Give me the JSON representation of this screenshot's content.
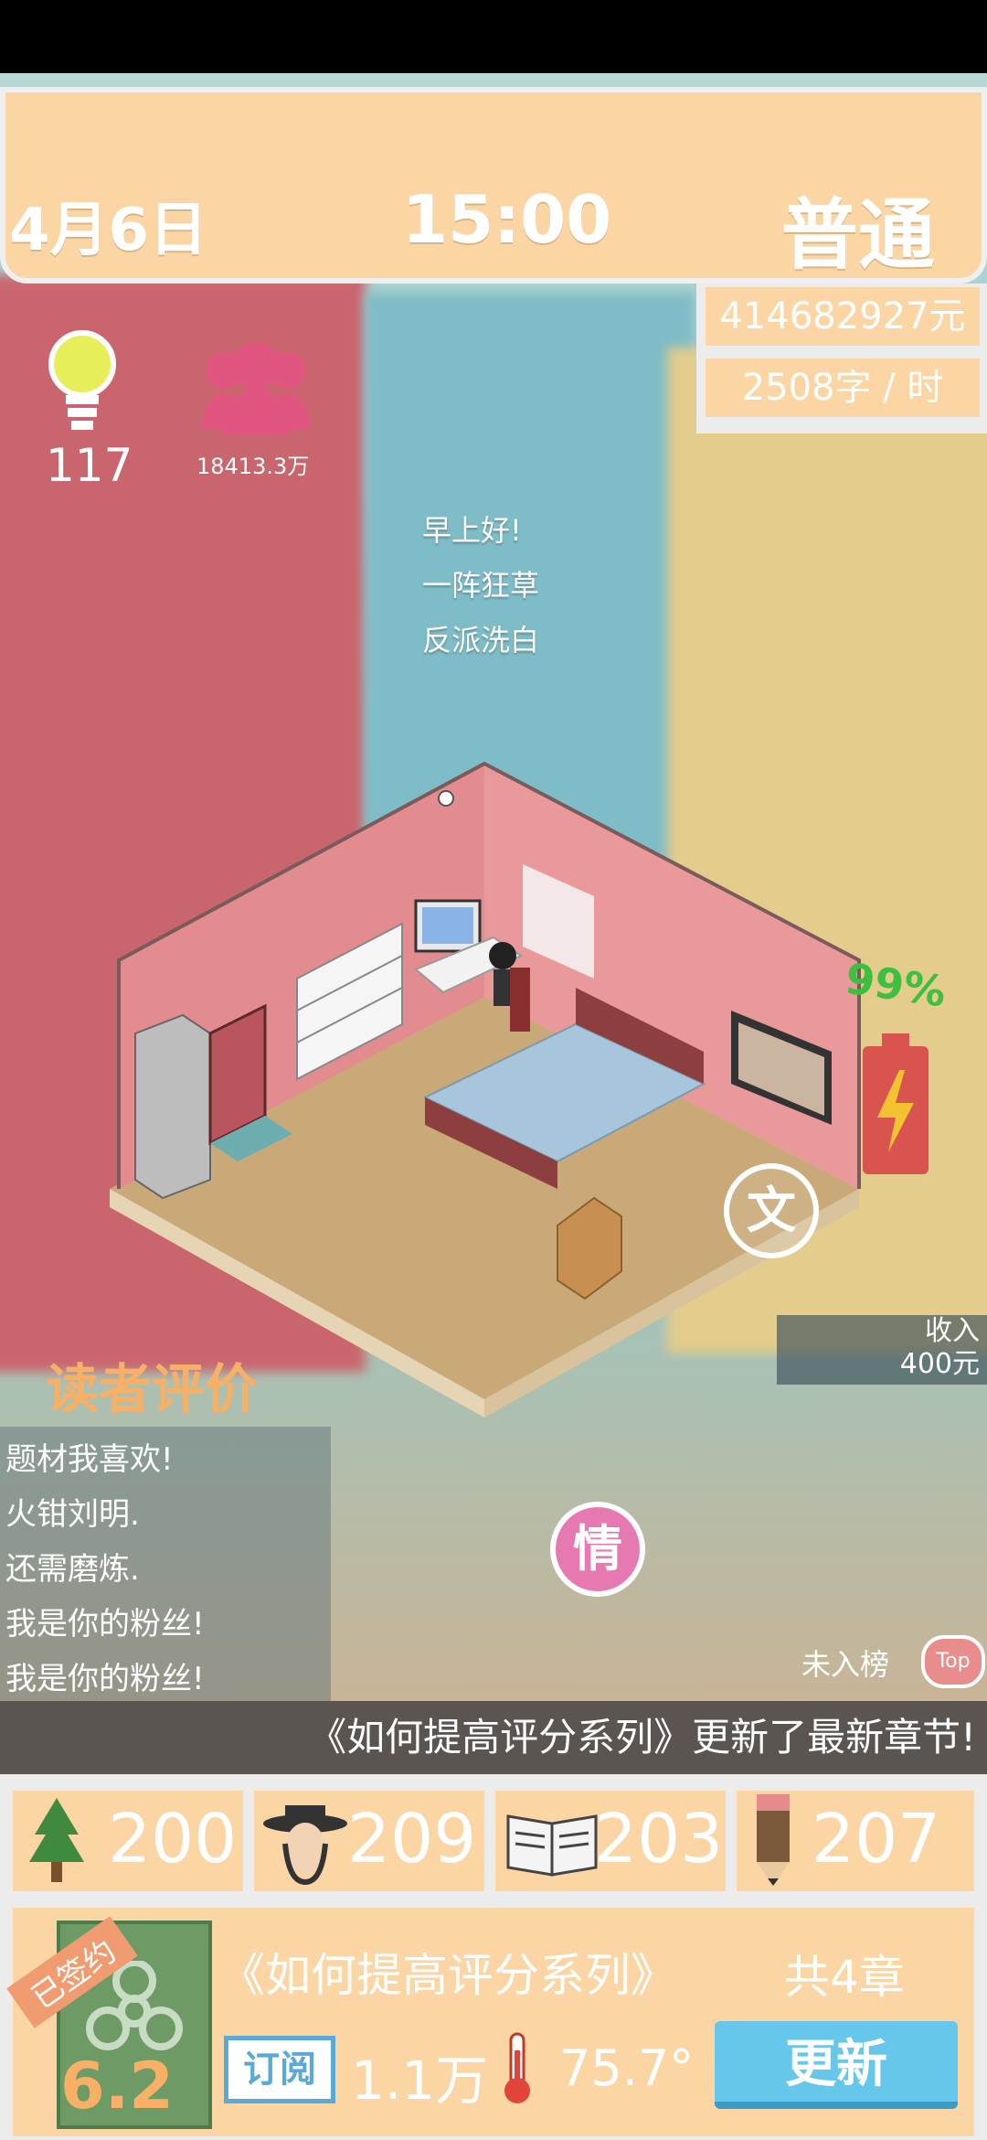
{
  "header": {
    "date": "4月6日",
    "time": "15:00",
    "mode": "普通"
  },
  "money": {
    "balance": "414682927元",
    "speed": "2508字 / 时"
  },
  "stats": {
    "inspiration": "117",
    "fans": "18413.3万"
  },
  "messages": [
    "早上好!",
    "一阵狂草",
    "反派洗白"
  ],
  "battery": {
    "percent": "99%"
  },
  "buttons": {
    "wen": "文",
    "qing": "情"
  },
  "income": {
    "label": "收入",
    "value": "400元"
  },
  "reviews": {
    "title": "读者评价",
    "items": [
      "题材我喜欢!",
      "火钳刘明.",
      "还需磨炼.",
      "我是你的粉丝!",
      "我是你的粉丝!"
    ]
  },
  "rank": {
    "label": "未入榜",
    "badge": "Top"
  },
  "news": "《如何提高评分系列》更新了最新章节!",
  "attributes": [
    {
      "icon": "tree-icon",
      "value": "200"
    },
    {
      "icon": "character-icon",
      "value": "209"
    },
    {
      "icon": "book-icon",
      "value": "203"
    },
    {
      "icon": "pencil-icon",
      "value": "207"
    }
  ],
  "book": {
    "signed": "已签约",
    "rating": "6.2",
    "title": "《如何提高评分系列》",
    "chapters": "共4章",
    "subscribe_label": "订阅",
    "subscribers": "1.1万",
    "temperature": "75.7°",
    "update_label": "更新"
  },
  "colors": {
    "panel": "#fbd6a4",
    "accent_blue": "#67c7ea",
    "fans_pink": "#e0557f",
    "battery_red": "#d9534f",
    "battery_green": "#3fbf3f"
  }
}
